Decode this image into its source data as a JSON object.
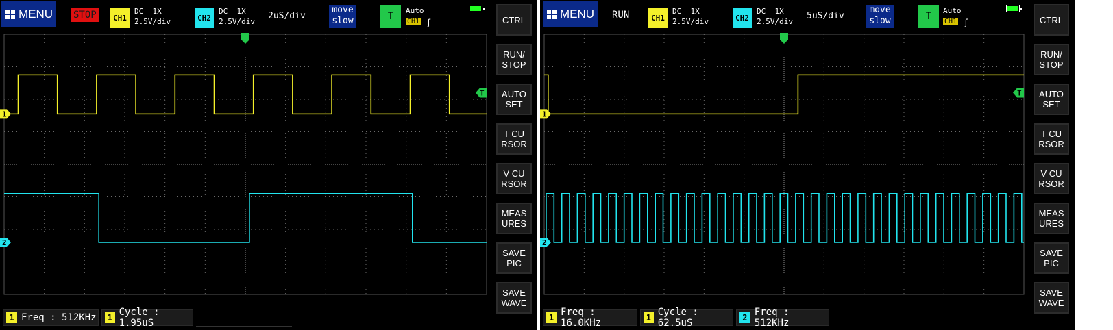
{
  "colors": {
    "ch1": "#f4f02a",
    "ch2": "#22e4ee",
    "grid": "#6a6a6a",
    "trigger": "#22c84a",
    "stop": "#e01010"
  },
  "scopes": [
    {
      "menu_label": "MENU",
      "run_state": "STOP",
      "ch1": {
        "tag": "CH1",
        "coupling": "DC  1X",
        "scale": "2.5V/div"
      },
      "ch2": {
        "tag": "CH2",
        "coupling": "DC  1X",
        "scale": "2.5V/div"
      },
      "timebase": "2uS/div",
      "move_label": "move\nslow",
      "trigger": {
        "tag": "T",
        "mode": "Auto",
        "source": "CH1",
        "edge": "ƒ"
      },
      "markers": {
        "ch1": "1",
        "ch2": "2",
        "trig": "T"
      },
      "sidebar": [
        "CTRL",
        "RUN/\nSTOP",
        "AUTO\nSET",
        "T CU\nRSOR",
        "V CU\nRSOR",
        "MEAS\nURES",
        "SAVE\nPIC",
        "SAVE\nWAVE"
      ],
      "measurements": [
        {
          "channel": "1",
          "label": "Freq",
          "value": "512KHz"
        },
        {
          "channel": "1",
          "label": "Cycle",
          "value": "1.95uS"
        }
      ],
      "ch1_wave": {
        "period_div": 1.95,
        "first_rise_div": 0.35,
        "duty": 0.5,
        "high_div": 2.75,
        "low_div": 1.55,
        "ends_low": false
      },
      "ch2_wave": {
        "period_div": 7.8,
        "first_rise_div": -1.7,
        "duty": 0.52,
        "high_div": -0.9,
        "low_div": -2.4
      }
    },
    {
      "menu_label": "MENU",
      "run_state": "RUN",
      "ch1": {
        "tag": "CH1",
        "coupling": "DC  1X",
        "scale": "2.5V/div"
      },
      "ch2": {
        "tag": "CH2",
        "coupling": "DC  1X",
        "scale": "2.5V/div"
      },
      "timebase": "5uS/div",
      "move_label": "move\nslow",
      "trigger": {
        "tag": "T",
        "mode": "Auto",
        "source": "CH1",
        "edge": "ƒ"
      },
      "markers": {
        "ch1": "1",
        "ch2": "2",
        "trig": "T"
      },
      "sidebar": [
        "CTRL",
        "RUN/\nSTOP",
        "AUTO\nSET",
        "T CU\nRSOR",
        "V CU\nRSOR",
        "MEAS\nURES",
        "SAVE\nPIC",
        "SAVE\nWAVE"
      ],
      "measurements": [
        {
          "channel": "1",
          "label": "Freq",
          "value": "16.0KHz"
        },
        {
          "channel": "1",
          "label": "Cycle",
          "value": "62.5uS"
        },
        {
          "channel": "2",
          "label": "Freq",
          "value": "512KHz"
        }
      ],
      "ch1_wave": {
        "period_div": 12.5,
        "first_rise_div": 6.35,
        "duty": 0.5,
        "high_div": 2.75,
        "low_div": 1.55
      },
      "ch2_wave": {
        "period_div": 0.39,
        "first_rise_div": 0.05,
        "duty": 0.5,
        "high_div": -0.9,
        "low_div": -2.4
      }
    }
  ]
}
